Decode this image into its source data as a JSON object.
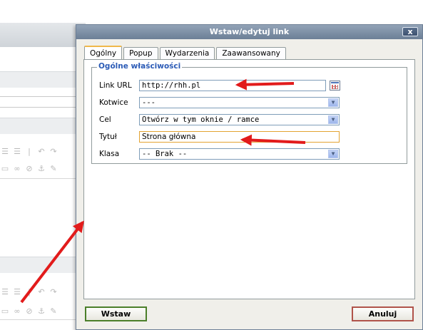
{
  "dialog": {
    "title": "Wstaw/edytuj link",
    "close_glyph": "x",
    "tabs": [
      {
        "label": "Ogólny",
        "active": true
      },
      {
        "label": "Popup",
        "active": false
      },
      {
        "label": "Wydarzenia",
        "active": false
      },
      {
        "label": "Zaawansowany",
        "active": false
      }
    ],
    "section_title": "Ogólne właściwości",
    "fields": {
      "link_url": {
        "label": "Link URL",
        "value": "http://rhh.pl"
      },
      "anchors": {
        "label": "Kotwice",
        "value": "---"
      },
      "target": {
        "label": "Cel",
        "value": "Otwórz w tym oknie / ramce"
      },
      "title": {
        "label": "Tytuł",
        "value": "Strona główna"
      },
      "class": {
        "label": "Klasa",
        "value": "-- Brak --"
      }
    },
    "buttons": {
      "insert": "Wstaw",
      "cancel": "Anuluj"
    }
  },
  "icons": [
    "browse-icon",
    "close-icon",
    "dropdown-arrow-icon",
    "red-arrow-icon"
  ],
  "colors": {
    "titlebar": "#6c7f96",
    "legend": "#2b5bb6",
    "focus_border": "#e3a332",
    "annotation_arrow": "#e21b1b",
    "insert_border": "#4b7f2a",
    "cancel_border": "#b0534a"
  }
}
